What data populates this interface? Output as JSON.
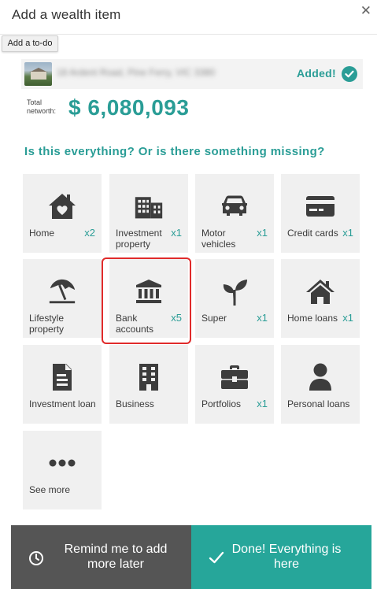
{
  "dialog": {
    "title": "Add a wealth item",
    "close_icon": "close-icon",
    "tooltip": "Add a to-do"
  },
  "added_item": {
    "address": "18 Ardent Road, Pine Ferry, VIC 3380",
    "status": "Added!",
    "status_icon": "check-circle-icon"
  },
  "networth": {
    "label": "Total networth:",
    "value": "$ 6,080,093"
  },
  "question": "Is this everything? Or is there something missing?",
  "tiles": [
    {
      "label": "Home",
      "count": "x2",
      "icon": "home-heart-icon"
    },
    {
      "label": "Investment property",
      "count": "x1",
      "icon": "buildings-icon"
    },
    {
      "label": "Motor vehicles",
      "count": "x1",
      "icon": "car-icon"
    },
    {
      "label": "Credit cards",
      "count": "x1",
      "icon": "credit-card-icon"
    },
    {
      "label": "Lifestyle property",
      "count": "",
      "icon": "beach-umbrella-icon"
    },
    {
      "label": "Bank accounts",
      "count": "x5",
      "icon": "bank-icon"
    },
    {
      "label": "Super",
      "count": "x1",
      "icon": "sprout-icon"
    },
    {
      "label": "Home loans",
      "count": "x1",
      "icon": "home-icon"
    },
    {
      "label": "Investment loan",
      "count": "",
      "icon": "document-icon"
    },
    {
      "label": "Business",
      "count": "",
      "icon": "office-building-icon"
    },
    {
      "label": "Portfolios",
      "count": "x1",
      "icon": "briefcase-icon"
    },
    {
      "label": "Personal loans",
      "count": "",
      "icon": "person-icon"
    },
    {
      "label": "See more",
      "count": "",
      "icon": "more-dots-icon"
    }
  ],
  "footer": {
    "remind_label": "Remind me to add more later",
    "remind_icon": "clock-icon",
    "done_label": "Done! Everything is here",
    "done_icon": "checkmark-icon"
  },
  "colors": {
    "accent": "#2a9d96",
    "done_button": "#26a69a",
    "remind_button": "#555555",
    "tile_bg": "#f0f0f0",
    "highlight": "#e02a2a"
  }
}
